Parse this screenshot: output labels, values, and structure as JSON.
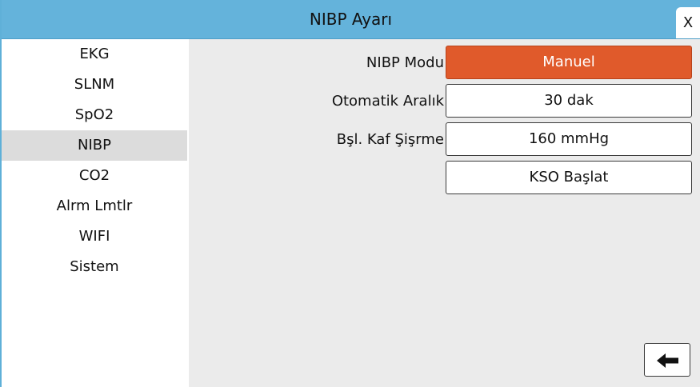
{
  "window": {
    "title": "NIBP Ayarı",
    "close_label": "X"
  },
  "sidebar": {
    "items": [
      {
        "label": "EKG"
      },
      {
        "label": "SLNM"
      },
      {
        "label": "SpO2"
      },
      {
        "label": "NIBP",
        "active": true
      },
      {
        "label": "CO2"
      },
      {
        "label": "Alrm Lmtlr"
      },
      {
        "label": "WIFI"
      },
      {
        "label": "Sistem"
      }
    ]
  },
  "settings": {
    "mode": {
      "label": "NIBP Modu",
      "value": "Manuel"
    },
    "interval": {
      "label": "Otomatik Aralık",
      "value": "30 dak"
    },
    "inflation": {
      "label": "Bşl. Kaf Şişrme",
      "value": "160 mmHg"
    },
    "kso_button": "KSO Başlat"
  },
  "footer": {
    "back_icon": "arrow-left-icon"
  },
  "colors": {
    "titlebar": "#64b3db",
    "accent": "#e05a2b",
    "selected": "#dcdcdc",
    "panel": "#ebebeb"
  }
}
